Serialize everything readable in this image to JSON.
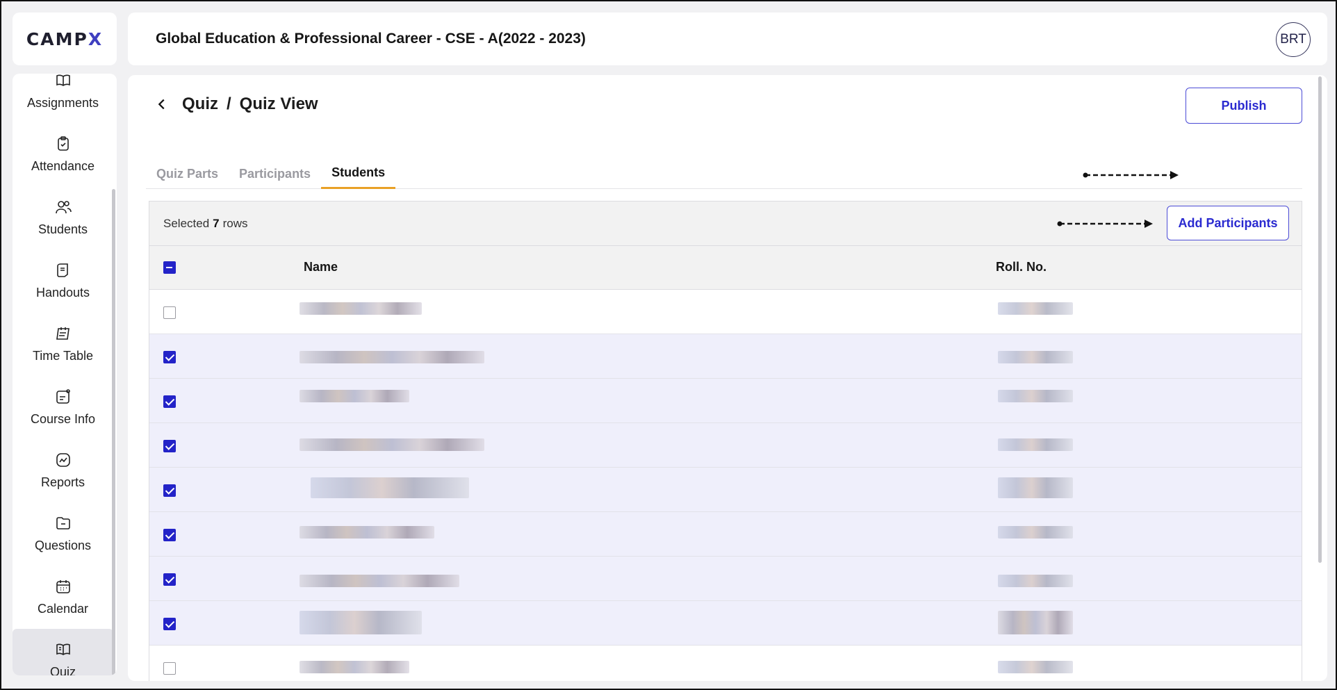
{
  "logo": {
    "text_main": "CAMP",
    "text_accent": "X"
  },
  "header": {
    "title": "Global Education & Professional Career - CSE - A(2022 - 2023)",
    "avatar": "BRT"
  },
  "sidebar": {
    "items": [
      {
        "label": "Assignments",
        "icon": "book-icon"
      },
      {
        "label": "Attendance",
        "icon": "clipboard-check-icon"
      },
      {
        "label": "Students",
        "icon": "users-icon"
      },
      {
        "label": "Handouts",
        "icon": "handout-icon"
      },
      {
        "label": "Time Table",
        "icon": "timetable-icon"
      },
      {
        "label": "Course Info",
        "icon": "course-info-icon"
      },
      {
        "label": "Reports",
        "icon": "reports-icon"
      },
      {
        "label": "Questions",
        "icon": "folder-icon"
      },
      {
        "label": "Calendar",
        "icon": "calendar-icon"
      },
      {
        "label": "Quiz",
        "icon": "quiz-book-icon",
        "active": true
      }
    ]
  },
  "breadcrumb": {
    "parent": "Quiz",
    "separator": "/",
    "current": "Quiz View"
  },
  "actions": {
    "publish": "Publish",
    "add_participants": "Add Participants"
  },
  "tabs": [
    {
      "label": "Quiz Parts",
      "active": false
    },
    {
      "label": "Participants",
      "active": false
    },
    {
      "label": "Students",
      "active": true
    }
  ],
  "selection": {
    "prefix": "Selected",
    "count": "7",
    "suffix": "rows"
  },
  "table": {
    "columns": {
      "name": "Name",
      "roll": "Roll. No."
    },
    "rows": [
      {
        "checked": false
      },
      {
        "checked": true
      },
      {
        "checked": true
      },
      {
        "checked": true
      },
      {
        "checked": true
      },
      {
        "checked": true
      },
      {
        "checked": true
      },
      {
        "checked": true
      },
      {
        "checked": false
      }
    ]
  },
  "colors": {
    "accent": "#2323c8",
    "tab_underline": "#e9a126",
    "selected_row": "#efeffb"
  }
}
